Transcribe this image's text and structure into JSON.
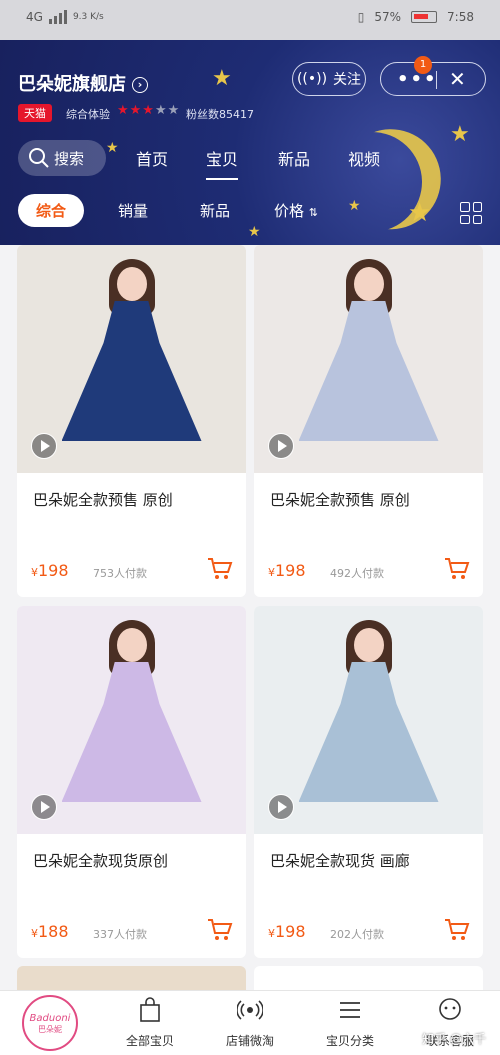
{
  "status_bar": {
    "network": "4G",
    "speed": "9.3 K/s",
    "battery": "57%",
    "time": "7:58"
  },
  "store": {
    "name": "巴朵妮旗舰店",
    "badge": "天猫",
    "rating_label": "综合体验",
    "rating_stars": 3,
    "rating_max": 5,
    "fans": "粉丝数85417",
    "follow_label": "关注",
    "notification_count": "1"
  },
  "search": {
    "label": "搜索"
  },
  "tabs": [
    "首页",
    "宝贝",
    "新品",
    "视频"
  ],
  "active_tab": "宝贝",
  "sort_options": [
    "综合",
    "销量",
    "新品",
    "价格"
  ],
  "active_sort": "综合",
  "products": [
    {
      "name": "巴朵妮全款预售 原创",
      "price": "198",
      "sold": "753人付款",
      "dress_color": "#1f3a7a",
      "bg": "#e9e5df"
    },
    {
      "name": "巴朵妮全款预售 原创",
      "price": "198",
      "sold": "492人付款",
      "dress_color": "#b8c3dd",
      "bg": "#ece8e6"
    },
    {
      "name": "巴朵妮全款现货原创",
      "price": "188",
      "sold": "337人付款",
      "dress_color": "#cdb9e6",
      "bg": "#efe9f2"
    },
    {
      "name": "巴朵妮全款现货 画廊",
      "price": "198",
      "sold": "202人付款",
      "dress_color": "#a9c0d6",
      "bg": "#eaeef0"
    }
  ],
  "currency": "¥",
  "bottom_nav": {
    "logo_text": "Baduoni",
    "logo_sub": "巴朵妮",
    "items": [
      "全部宝贝",
      "店铺微淘",
      "宝贝分类",
      "联系客服"
    ]
  },
  "watermark": "知乎 @六千"
}
